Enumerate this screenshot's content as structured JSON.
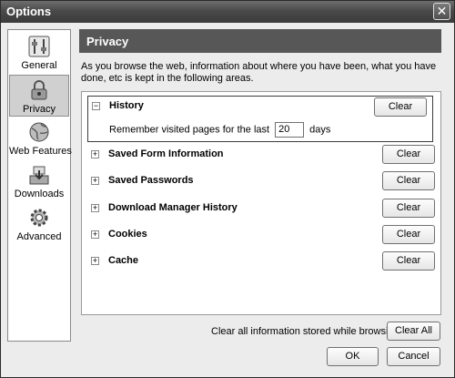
{
  "window": {
    "title": "Options",
    "close_glyph": "✕"
  },
  "sidebar": {
    "items": [
      {
        "label": "General",
        "icon": "switches-icon",
        "selected": false
      },
      {
        "label": "Privacy",
        "icon": "lock-icon",
        "selected": true
      },
      {
        "label": "Web Features",
        "icon": "globe-icon",
        "selected": false
      },
      {
        "label": "Downloads",
        "icon": "download-tray-icon",
        "selected": false
      },
      {
        "label": "Advanced",
        "icon": "gear-icon",
        "selected": false
      }
    ]
  },
  "panel": {
    "title": "Privacy",
    "description": "As you browse the web, information about where you have been, what you have done, etc is kept in the following areas."
  },
  "items": [
    {
      "label": "History",
      "expanded": true,
      "button": "Clear",
      "sub_prefix": "Remember visited pages for the last",
      "sub_value": "20",
      "sub_suffix": "days"
    },
    {
      "label": "Saved Form Information",
      "expanded": false,
      "button": "Clear"
    },
    {
      "label": "Saved Passwords",
      "expanded": false,
      "button": "Clear"
    },
    {
      "label": "Download Manager History",
      "expanded": false,
      "button": "Clear"
    },
    {
      "label": "Cookies",
      "expanded": false,
      "button": "Clear"
    },
    {
      "label": "Cache",
      "expanded": false,
      "button": "Clear"
    }
  ],
  "footer": {
    "clear_all_text": "Clear all information stored while browsing:",
    "clear_all_button": "Clear All",
    "ok_button": "OK",
    "cancel_button": "Cancel"
  },
  "glyphs": {
    "collapsed": "+",
    "expanded": "−"
  }
}
